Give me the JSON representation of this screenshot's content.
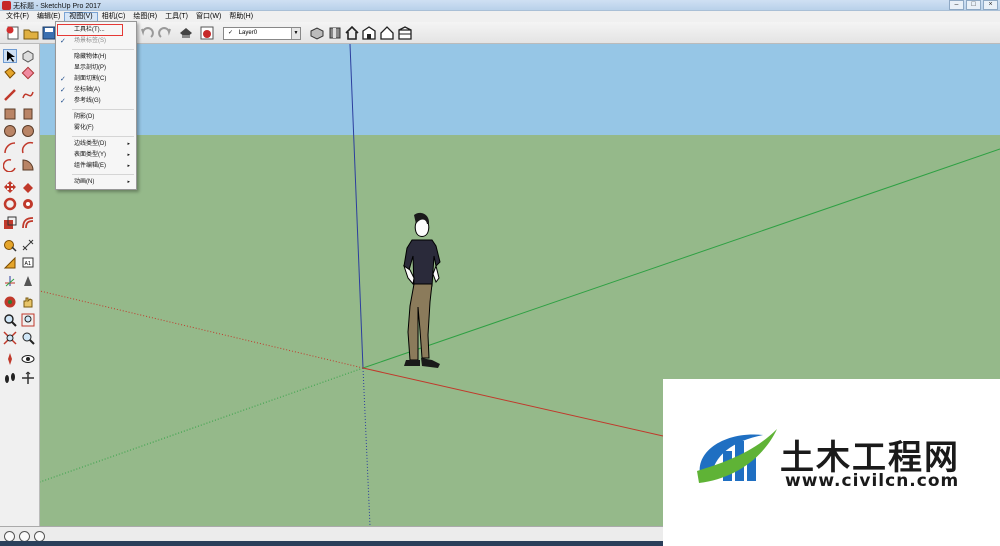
{
  "window": {
    "title": "无标题 - SketchUp Pro 2017"
  },
  "menubar": {
    "items": [
      {
        "label": "文件(F)"
      },
      {
        "label": "编辑(E)"
      },
      {
        "label": "视图(V)"
      },
      {
        "label": "相机(C)"
      },
      {
        "label": "绘图(R)"
      },
      {
        "label": "工具(T)"
      },
      {
        "label": "窗口(W)"
      },
      {
        "label": "帮助(H)"
      }
    ]
  },
  "toolbar": {
    "layer_selected": "Layer0"
  },
  "view_menu": {
    "items": [
      {
        "label": "工具栏(T)...",
        "checked": false,
        "disabled": false
      },
      {
        "label": "场景标签(S)",
        "checked": true,
        "disabled": true
      },
      {
        "label": "隐藏物体(H)",
        "checked": false,
        "disabled": false
      },
      {
        "label": "显示剖切(P)",
        "checked": false,
        "disabled": false
      },
      {
        "label": "剖面切割(C)",
        "checked": true,
        "disabled": false
      },
      {
        "label": "坐标轴(A)",
        "checked": true,
        "disabled": false
      },
      {
        "label": "参考线(G)",
        "checked": true,
        "disabled": false
      },
      {
        "label": "阴影(D)",
        "checked": false,
        "disabled": false
      },
      {
        "label": "雾化(F)",
        "checked": false,
        "disabled": false
      },
      {
        "label": "边线类型(D)",
        "checked": false,
        "disabled": false
      },
      {
        "label": "表面类型(Y)",
        "checked": false,
        "disabled": false
      },
      {
        "label": "组件编辑(E)",
        "checked": false,
        "disabled": false
      },
      {
        "label": "动画(N)",
        "checked": false,
        "disabled": false
      }
    ],
    "check_glyph": "✓",
    "submenu_glyph": "▸"
  },
  "watermark": {
    "name": "土木工程网",
    "url": "www.civilcn.com"
  },
  "colors": {
    "sky": "#96c6e6",
    "ground": "#95b98a",
    "axis_red": "#c0392b",
    "axis_green": "#2ea043",
    "axis_blue": "#2c3e9e",
    "logo_blue": "#1f6fc2",
    "logo_green": "#5fb336"
  }
}
